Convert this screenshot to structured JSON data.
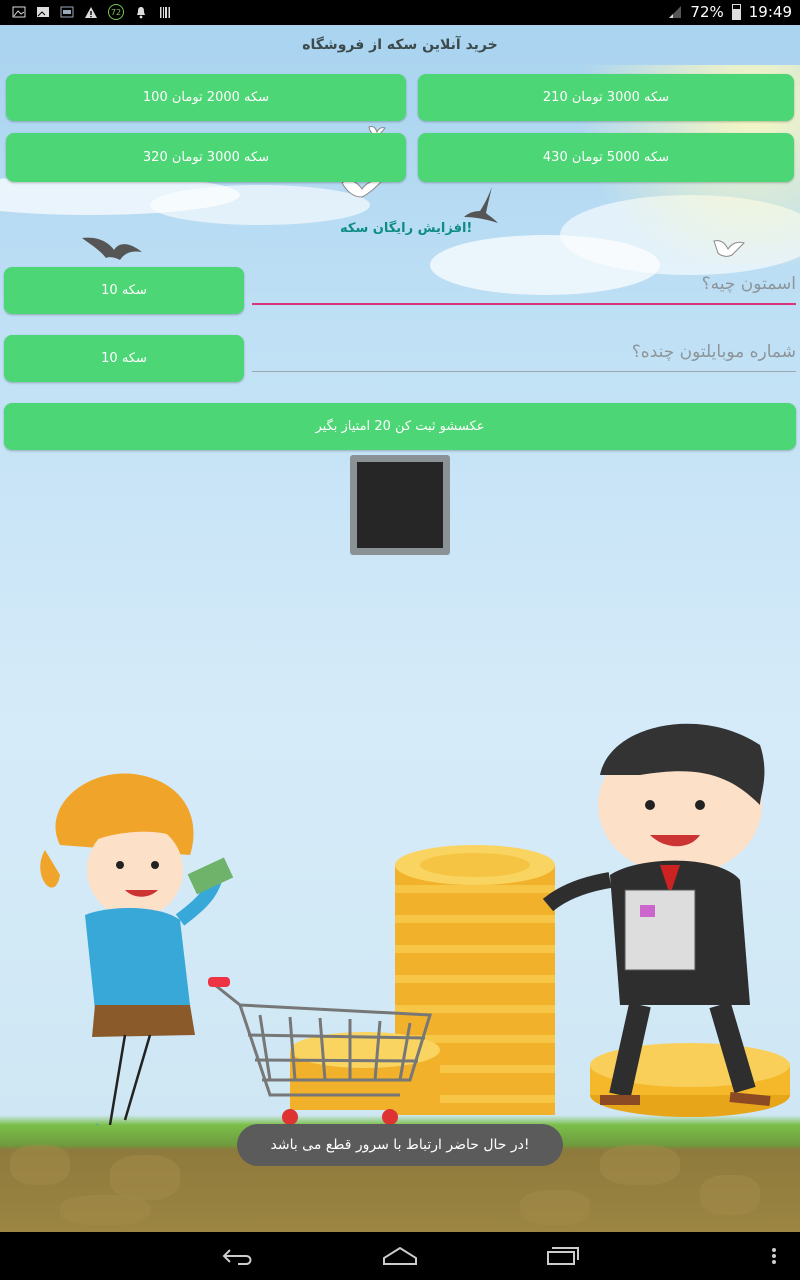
{
  "status_bar": {
    "battery_text": "72%",
    "time": "19:49",
    "notification_badge": "72",
    "battery_level": 0.72,
    "icons": [
      "image-icon",
      "gallery-icon",
      "id-card-icon",
      "warning-icon",
      "circle-72-icon",
      "notification-bell-icon",
      "barcode-icon"
    ]
  },
  "store": {
    "title": "خرید آنلاین سکه از فروشگاه",
    "packages": [
      {
        "label": "210 سکه 3000 تومان"
      },
      {
        "label": "100 سکه 2000 تومان"
      },
      {
        "label": "430 سکه 5000 تومان"
      },
      {
        "label": "320 سکه 3000 تومان"
      }
    ]
  },
  "free_coins": {
    "heading": "افزایش رایگان سکه!",
    "name_field": {
      "placeholder": "اسمتون چیه؟",
      "value": ""
    },
    "name_reward_label": "10 سکه",
    "phone_field": {
      "placeholder": "شماره موبایلتون چنده؟",
      "value": ""
    },
    "phone_reward_label": "10 سکه",
    "photo_button_label": "عکسشو ثبت کن 20 امتیاز بگیر"
  },
  "toast": {
    "message": "در حال حاضر ارتباط با سرور قطع می باشد!"
  },
  "colors": {
    "button_green": "#4cd675",
    "accent_teal": "#0f8c84",
    "field_active": "#d8357a"
  },
  "nav_bar": {
    "icons": [
      "back-icon",
      "home-icon",
      "recents-icon",
      "more-icon"
    ]
  }
}
